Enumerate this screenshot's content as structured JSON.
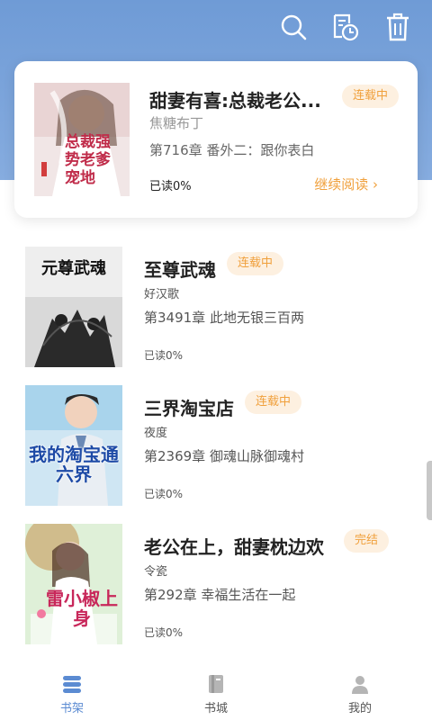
{
  "header": {
    "icons": [
      "search-icon",
      "history-icon",
      "trash-icon"
    ],
    "bg_color": "#7aa2da"
  },
  "featured": {
    "title": "甜妻有喜:总裁老公...",
    "status": "连载中",
    "author": "焦糖布丁",
    "chapter": "第716章 番外二：跟你表白",
    "progress": "已读0%",
    "continue_label": "继续阅读 ›",
    "cover_text": "总裁强势老爹宠地"
  },
  "books": [
    {
      "title": "至尊武魂",
      "status": "连载中",
      "author": "好汉歌",
      "chapter": "第3491章 此地无银三百两",
      "progress": "已读0%",
      "cover_text": "元尊武魂"
    },
    {
      "title": "三界淘宝店",
      "status": "连载中",
      "author": "夜度",
      "chapter": "第2369章 御魂山脉御魂村",
      "progress": "已读0%",
      "cover_text": "我的淘宝通六界"
    },
    {
      "title": "老公在上，甜妻枕边欢",
      "status": "完结",
      "author": "令瓷",
      "chapter": "第292章 幸福生活在一起",
      "progress": "已读0%",
      "cover_text": "雷小椒上身"
    }
  ],
  "tabbar": {
    "tabs": [
      {
        "label": "书架",
        "icon": "bookshelf-icon",
        "active": true
      },
      {
        "label": "书城",
        "icon": "bookstore-icon",
        "active": false
      },
      {
        "label": "我的",
        "icon": "user-icon",
        "active": false
      }
    ],
    "active_color": "#5b8bd2"
  },
  "colors": {
    "badge_bg": "#fdf0e0",
    "badge_text": "#f0a03c"
  }
}
